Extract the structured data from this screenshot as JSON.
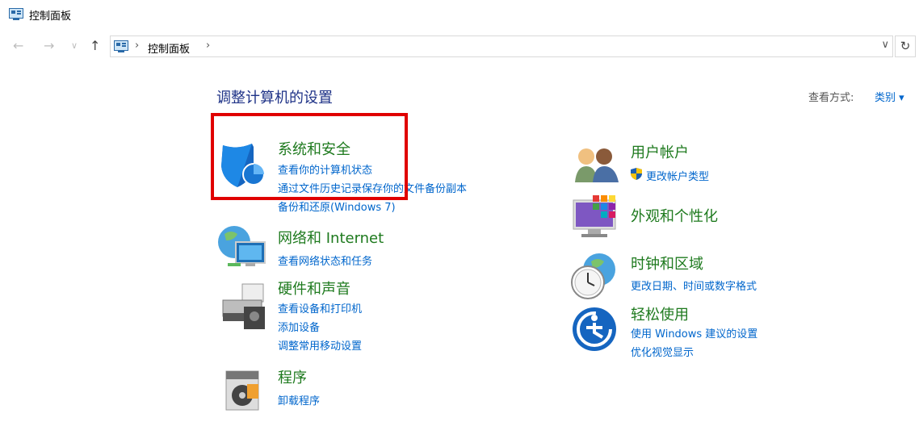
{
  "window": {
    "title": "控制面板"
  },
  "nav": {
    "back": "←",
    "forward": "→",
    "recent": "∨",
    "up": "↑",
    "refresh": "↻"
  },
  "address": {
    "separator": "›",
    "path": "控制面板",
    "separator2": "›",
    "dropdown": "∨"
  },
  "main": {
    "heading": "调整计算机的设置",
    "view_by_label": "查看方式:",
    "view_by_value": "类别 ▾"
  },
  "categories": {
    "system_security": {
      "title": "系统和安全",
      "links": [
        "查看你的计算机状态",
        "通过文件历史记录保存你的文件备份副本",
        "备份和还原(Windows 7)"
      ]
    },
    "network": {
      "title": "网络和 Internet",
      "links": [
        "查看网络状态和任务"
      ]
    },
    "hardware": {
      "title": "硬件和声音",
      "links": [
        "查看设备和打印机",
        "添加设备",
        "调整常用移动设置"
      ]
    },
    "programs": {
      "title": "程序",
      "links": [
        "卸载程序"
      ]
    },
    "accounts": {
      "title": "用户帐户",
      "links": [
        "更改帐户类型"
      ]
    },
    "appearance": {
      "title": "外观和个性化",
      "links": []
    },
    "clock": {
      "title": "时钟和区域",
      "links": [
        "更改日期、时间或数字格式"
      ]
    },
    "ease": {
      "title": "轻松使用",
      "links": [
        "使用 Windows 建议的设置",
        "优化视觉显示"
      ]
    }
  }
}
